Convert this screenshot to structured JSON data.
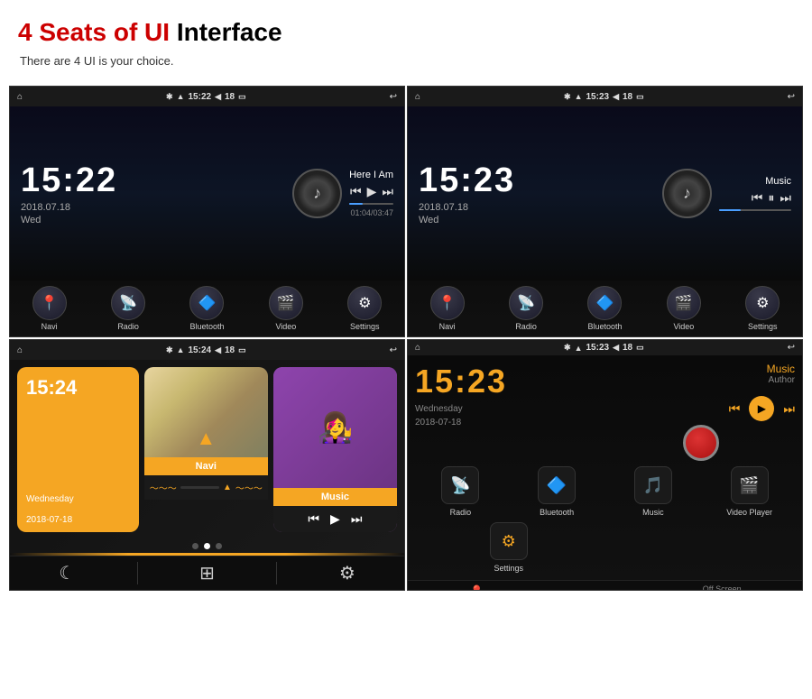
{
  "header": {
    "title_red": "4 Seats of UI",
    "title_black": "Interface",
    "subtitle": "There are 4 UI is your choice."
  },
  "panels": [
    {
      "id": "panel1",
      "statusbar": {
        "home": "⌂",
        "bluetooth": "✱",
        "signal": "▲",
        "time": "15:22",
        "volume": "◀",
        "battery": "18",
        "screen": "▭",
        "back": "↩"
      },
      "clock": "15:22",
      "date": "2018.07.18",
      "day": "Wed",
      "music_title": "Here I Am",
      "music_time": "01:04/03:47",
      "nav_items": [
        "Navi",
        "Radio",
        "Bluetooth",
        "Video",
        "Settings"
      ]
    },
    {
      "id": "panel2",
      "statusbar": {
        "time": "15:23",
        "battery": "18"
      },
      "clock": "15:23",
      "date": "2018.07.18",
      "day": "Wed",
      "music_title": "Music",
      "nav_items": [
        "Navi",
        "Radio",
        "Bluetooth",
        "Video",
        "Settings"
      ]
    },
    {
      "id": "panel3",
      "statusbar": {
        "time": "15:24",
        "battery": "18"
      },
      "cards": [
        {
          "type": "time",
          "time": "15:24",
          "date": "Wednesday",
          "date2": "2018-07-18"
        },
        {
          "type": "navi",
          "label": "Navi"
        },
        {
          "type": "music",
          "label": "Music"
        }
      ]
    },
    {
      "id": "panel4",
      "statusbar": {
        "time": "15:23",
        "battery": "18"
      },
      "clock": "15:23",
      "day": "Wednesday",
      "date": "2018-07-18",
      "music_label": "Music",
      "music_author": "Author",
      "apps": [
        {
          "label": "Radio",
          "icon": "📡"
        },
        {
          "label": "Bluetooth",
          "icon": "🔷"
        },
        {
          "label": "Music",
          "icon": "🎵"
        },
        {
          "label": "Video Player",
          "icon": "🎬"
        },
        {
          "label": "Settings",
          "icon": "⚙"
        }
      ],
      "bottom_nav": [
        {
          "label": "Navi",
          "icon": "📍"
        },
        {
          "label": "",
          "icon": "⚙⚙"
        },
        {
          "label": "Off Screen",
          "icon": "☾"
        }
      ]
    }
  ]
}
